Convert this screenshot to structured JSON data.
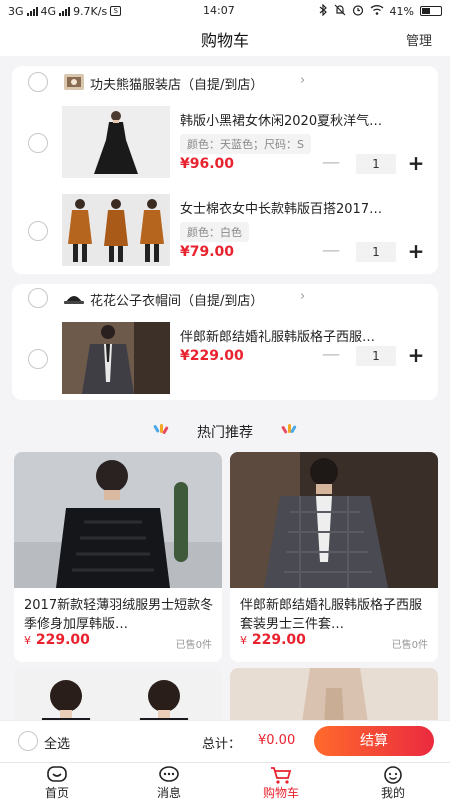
{
  "status_bar": {
    "network_left": "3G",
    "network_right": "4G",
    "speed": "9.7K/s",
    "time": "14:07",
    "battery": "41%"
  },
  "header": {
    "title": "购物车",
    "manage_label": "管理"
  },
  "shops": [
    {
      "name": "功夫熊猫服装店（自提/到店）",
      "items": [
        {
          "title": "韩版小黑裙女休闲2020夏秋洋气…",
          "spec": "颜色：天蓝色；尺码：S",
          "price": "¥96.00",
          "qty": "1"
        },
        {
          "title": "女士棉衣女中长款韩版百搭2017…",
          "spec": "颜色：白色",
          "price": "¥79.00",
          "qty": "1"
        }
      ]
    },
    {
      "name": "花花公子衣帽间（自提/到店）",
      "items": [
        {
          "title": "伴郎新郎结婚礼服韩版格子西服…",
          "spec": "",
          "price": "¥229.00",
          "qty": "1"
        }
      ]
    }
  ],
  "recommend": {
    "title": "热门推荐",
    "cards": [
      {
        "title": "2017新款轻薄羽绒服男士短款冬季修身加厚韩版…",
        "currency": "¥",
        "price": "229.00",
        "sold": "已售0件"
      },
      {
        "title": "伴郎新郎结婚礼服韩版格子西服套装男士三件套…",
        "currency": "¥",
        "price": "229.00",
        "sold": "已售0件"
      }
    ]
  },
  "cart_bar": {
    "select_all": "全选",
    "total_label": "总计：",
    "total_value": "¥0.00",
    "checkout": "结算"
  },
  "tabs": [
    {
      "label": "首页",
      "icon": "home-icon"
    },
    {
      "label": "消息",
      "icon": "message-icon"
    },
    {
      "label": "购物车",
      "icon": "cart-icon"
    },
    {
      "label": "我的",
      "icon": "profile-icon"
    }
  ],
  "colors": {
    "accent": "#e8232f",
    "checkout_from": "#ff6a2c",
    "checkout_to": "#ea2a3f"
  }
}
